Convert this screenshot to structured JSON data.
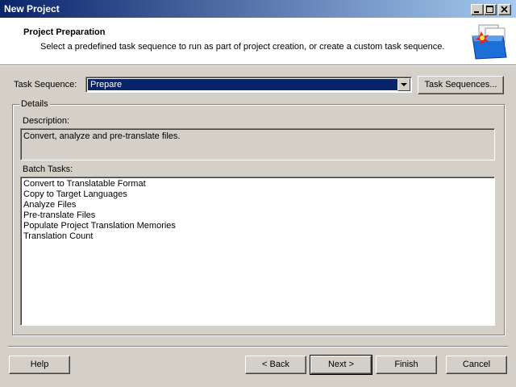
{
  "window": {
    "title": "New Project"
  },
  "header": {
    "title": "Project Preparation",
    "subtitle": "Select a predefined task sequence to run as part of project creation, or create a custom task sequence.",
    "icon": "project-box-icon"
  },
  "task_sequence": {
    "label": "Task Sequence:",
    "selected": "Prepare",
    "button_label": "Task Sequences..."
  },
  "details": {
    "group_label": "Details",
    "description_label": "Description:",
    "description": "Convert, analyze and pre-translate files.",
    "batch_tasks_label": "Batch Tasks:",
    "batch_tasks": [
      "Convert to Translatable Format",
      "Copy to Target Languages",
      "Analyze Files",
      "Pre-translate Files",
      "Populate Project Translation Memories",
      "Translation Count"
    ]
  },
  "footer": {
    "help": "Help",
    "back": "< Back",
    "next": "Next >",
    "finish": "Finish",
    "cancel": "Cancel"
  },
  "colors": {
    "titlebar_start": "#0a246a",
    "titlebar_end": "#a6caf0",
    "selection": "#0a246a",
    "face": "#d4d0c8"
  }
}
